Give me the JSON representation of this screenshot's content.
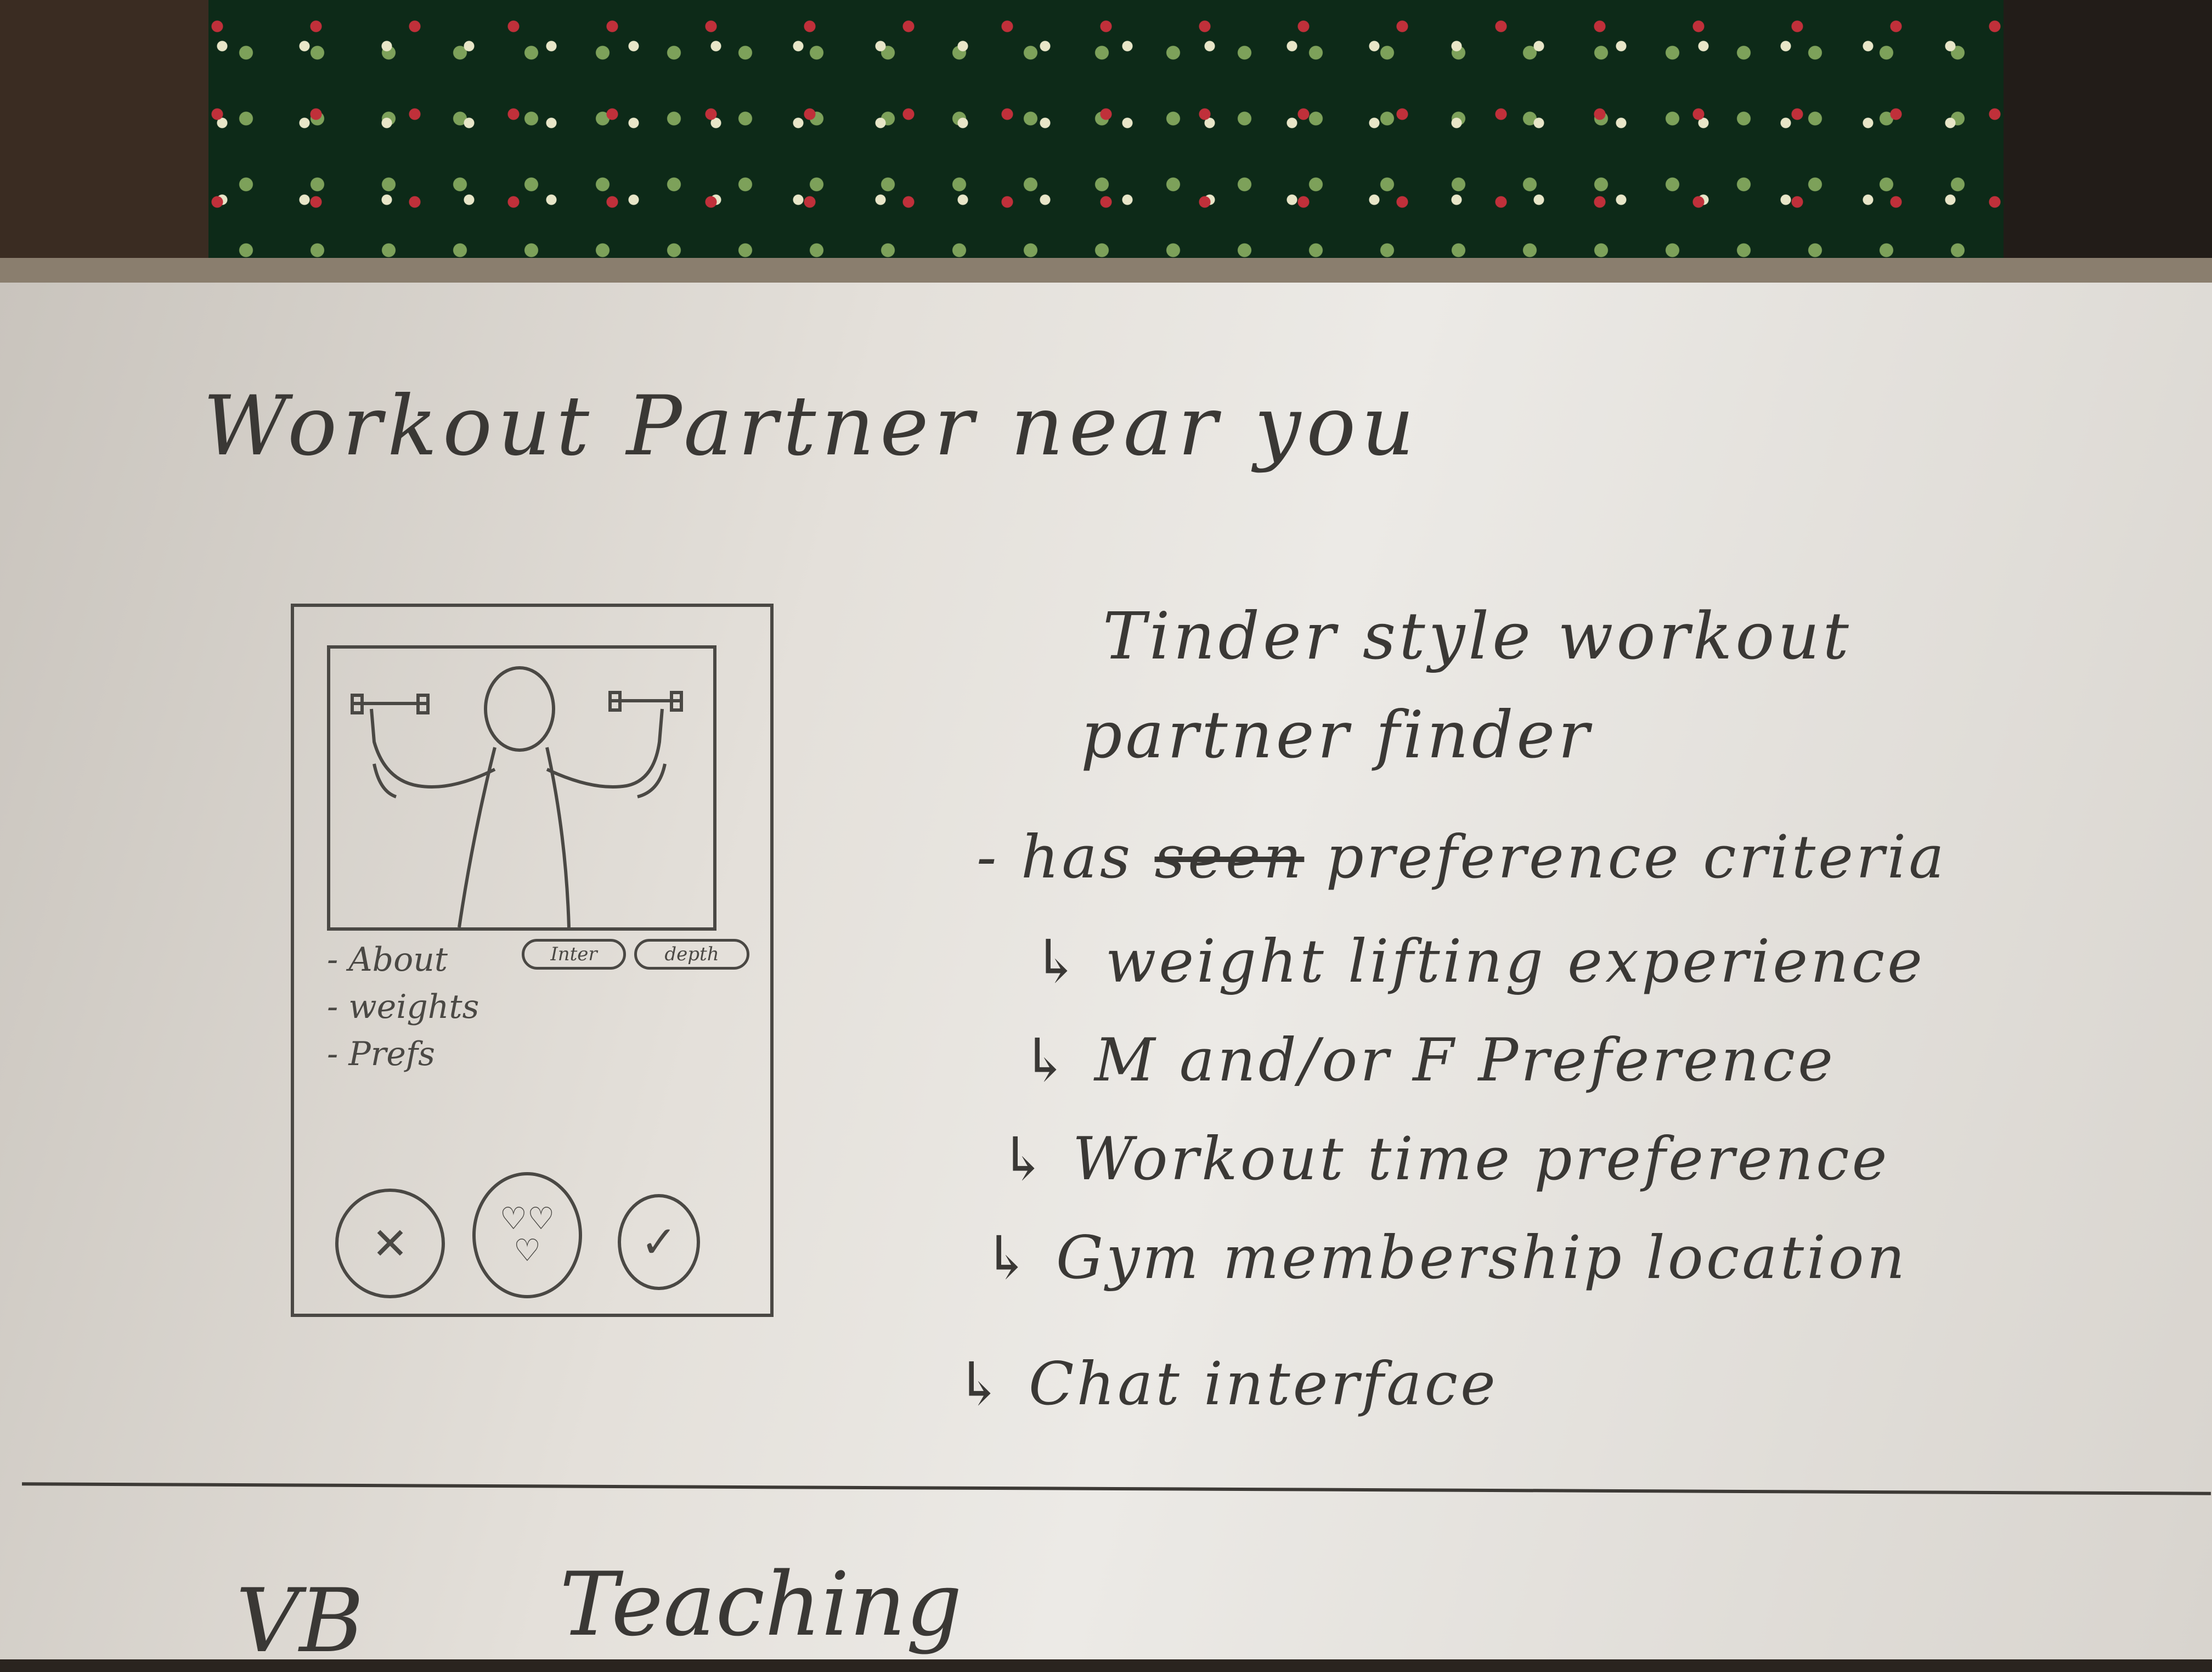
{
  "title": "Workout Partner near you",
  "description": {
    "line1": "Tinder style workout",
    "line2": "partner finder"
  },
  "criteria": {
    "prefix": "- has",
    "struck": "seen",
    "text": "preference criteria",
    "items": [
      "weight lifting experience",
      "M and/or F Preference",
      "Workout time preference",
      "Gym membership location",
      "Chat interface"
    ]
  },
  "phone": {
    "about_lines": [
      "- About",
      "- weights",
      "- Prefs"
    ],
    "pills": [
      "Inter",
      "depth"
    ],
    "buttons": {
      "reject": "✕",
      "love": "♡♡",
      "love2": "♡",
      "accept": "✓"
    }
  },
  "next_section": {
    "left": "VB",
    "right": "Teaching"
  }
}
